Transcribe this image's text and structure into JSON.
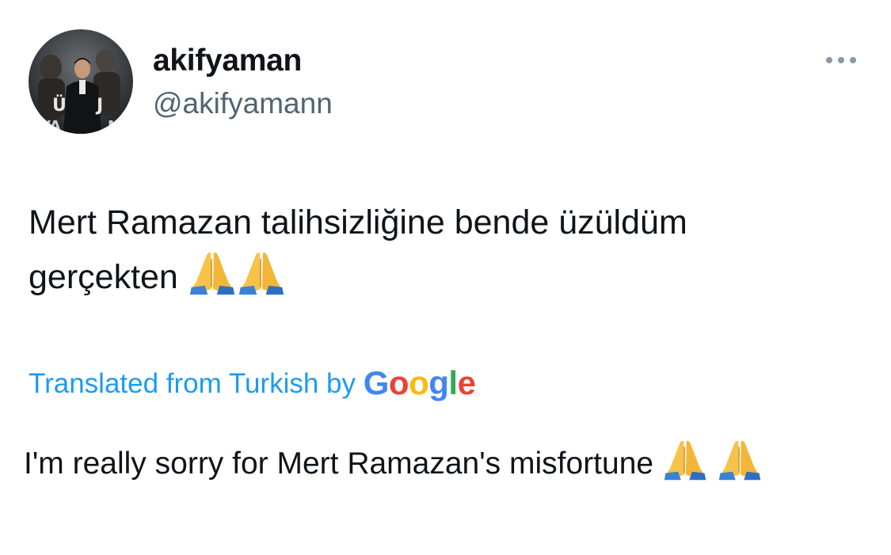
{
  "tweet": {
    "author": {
      "display_name": "akifyaman",
      "handle": "@akifyamann",
      "avatar_icon": "user-avatar-photo"
    },
    "more_icon": "more-dots-icon",
    "text_part1": "Mert Ramazan talihsizliğine bende üzüldüm gerçekten",
    "text_emojis": [
      "🙏",
      "🙏"
    ],
    "translation": {
      "label": "Translated from Turkish by",
      "provider": "Google",
      "provider_letters": [
        "G",
        "o",
        "o",
        "g",
        "l",
        "e"
      ],
      "provider_colors": [
        "#4285F4",
        "#EA4335",
        "#FBBC05",
        "#4285F4",
        "#34A853",
        "#EA4335"
      ],
      "text": "I'm really sorry for Mert Ramazan's misfortune",
      "emojis": [
        "🙏",
        "🙏"
      ]
    },
    "link_color": "#1d9bf0",
    "secondary_text_color": "#536471"
  }
}
